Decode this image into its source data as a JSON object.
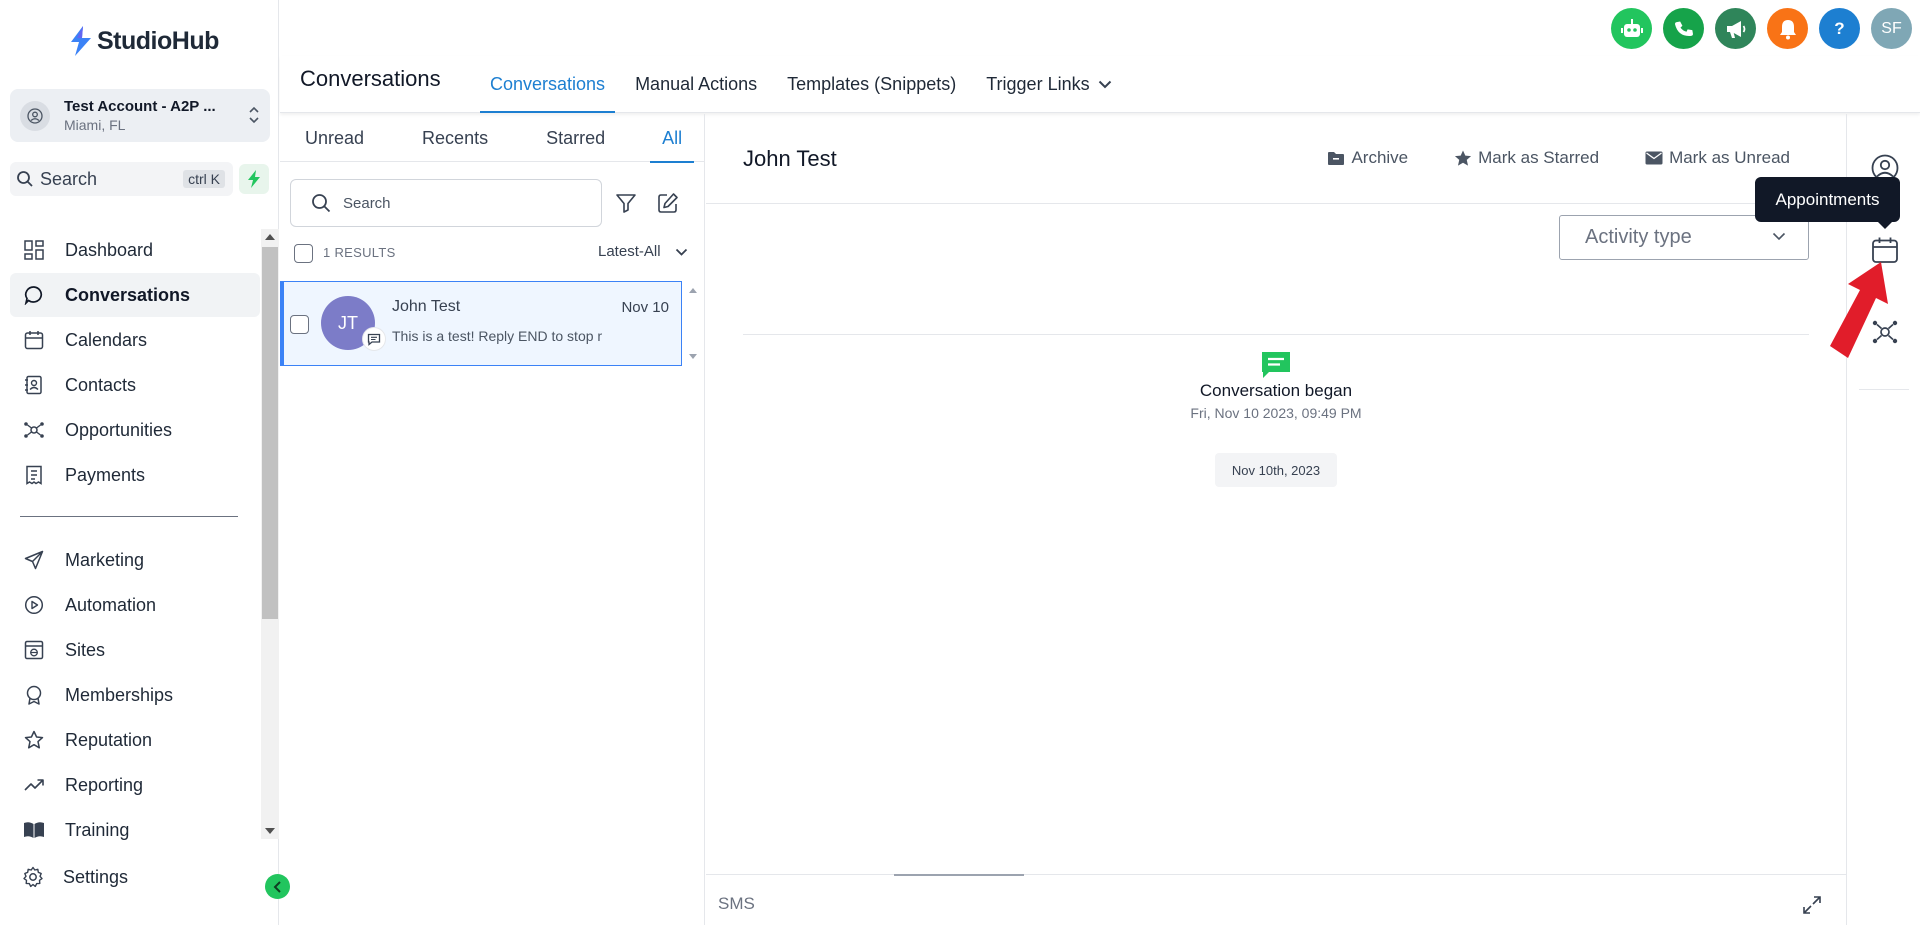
{
  "app": {
    "logo_text": "StudioHub"
  },
  "account": {
    "name": "Test Account - A2P ...",
    "location": "Miami, FL"
  },
  "sidebar_search": {
    "label": "Search",
    "shortcut": "ctrl K"
  },
  "nav": {
    "items": [
      {
        "label": "Dashboard",
        "icon": "grid-icon"
      },
      {
        "label": "Conversations",
        "icon": "chat-icon",
        "active": true
      },
      {
        "label": "Calendars",
        "icon": "calendar-icon"
      },
      {
        "label": "Contacts",
        "icon": "contacts-icon"
      },
      {
        "label": "Opportunities",
        "icon": "opportunities-icon"
      },
      {
        "label": "Payments",
        "icon": "payments-icon"
      }
    ],
    "items2": [
      {
        "label": "Marketing",
        "icon": "send-icon"
      },
      {
        "label": "Automation",
        "icon": "automation-icon"
      },
      {
        "label": "Sites",
        "icon": "sites-icon"
      },
      {
        "label": "Memberships",
        "icon": "badge-icon"
      },
      {
        "label": "Reputation",
        "icon": "star-icon"
      },
      {
        "label": "Reporting",
        "icon": "trend-icon"
      },
      {
        "label": "Training",
        "icon": "book-icon"
      }
    ],
    "settings_label": "Settings"
  },
  "topbar": {
    "icons": [
      {
        "name": "bot-icon",
        "color": "#22c55e"
      },
      {
        "name": "phone-icon",
        "color": "#16a34a"
      },
      {
        "name": "megaphone-icon",
        "color": "#2f855a"
      },
      {
        "name": "bell-icon",
        "color": "#f97316"
      },
      {
        "name": "help-icon",
        "color": "#1d7fd1",
        "text": "?"
      },
      {
        "name": "user-avatar",
        "color": "#7fa7b5",
        "text": "SF"
      }
    ]
  },
  "header": {
    "title": "Conversations",
    "tabs": [
      {
        "label": "Conversations",
        "active": true
      },
      {
        "label": "Manual Actions"
      },
      {
        "label": "Templates (Snippets)"
      },
      {
        "label": "Trigger Links"
      }
    ]
  },
  "list": {
    "filter_tabs": [
      "Unread",
      "Recents",
      "Starred",
      "All"
    ],
    "active_filter": "All",
    "search_placeholder": "Search",
    "results": "1 RESULTS",
    "sort": "Latest-All",
    "conversations": [
      {
        "initials": "JT",
        "name": "John Test",
        "date": "Nov 10",
        "preview": "This is a test! Reply END to stop m"
      }
    ]
  },
  "chat": {
    "contact_name": "John Test",
    "actions": [
      "Archive",
      "Mark as Starred",
      "Mark as Unread"
    ],
    "activity_placeholder": "Activity type",
    "began_title": "Conversation began",
    "began_time": "Fri, Nov 10 2023, 09:49 PM",
    "date_chip": "Nov 10th, 2023",
    "composer_label": "SMS"
  },
  "rail": {
    "tooltip": "Appointments"
  },
  "colors": {
    "accent": "#1d7fd1",
    "brand_green": "#22c55e",
    "annotation_arrow": "#e11d2a"
  }
}
